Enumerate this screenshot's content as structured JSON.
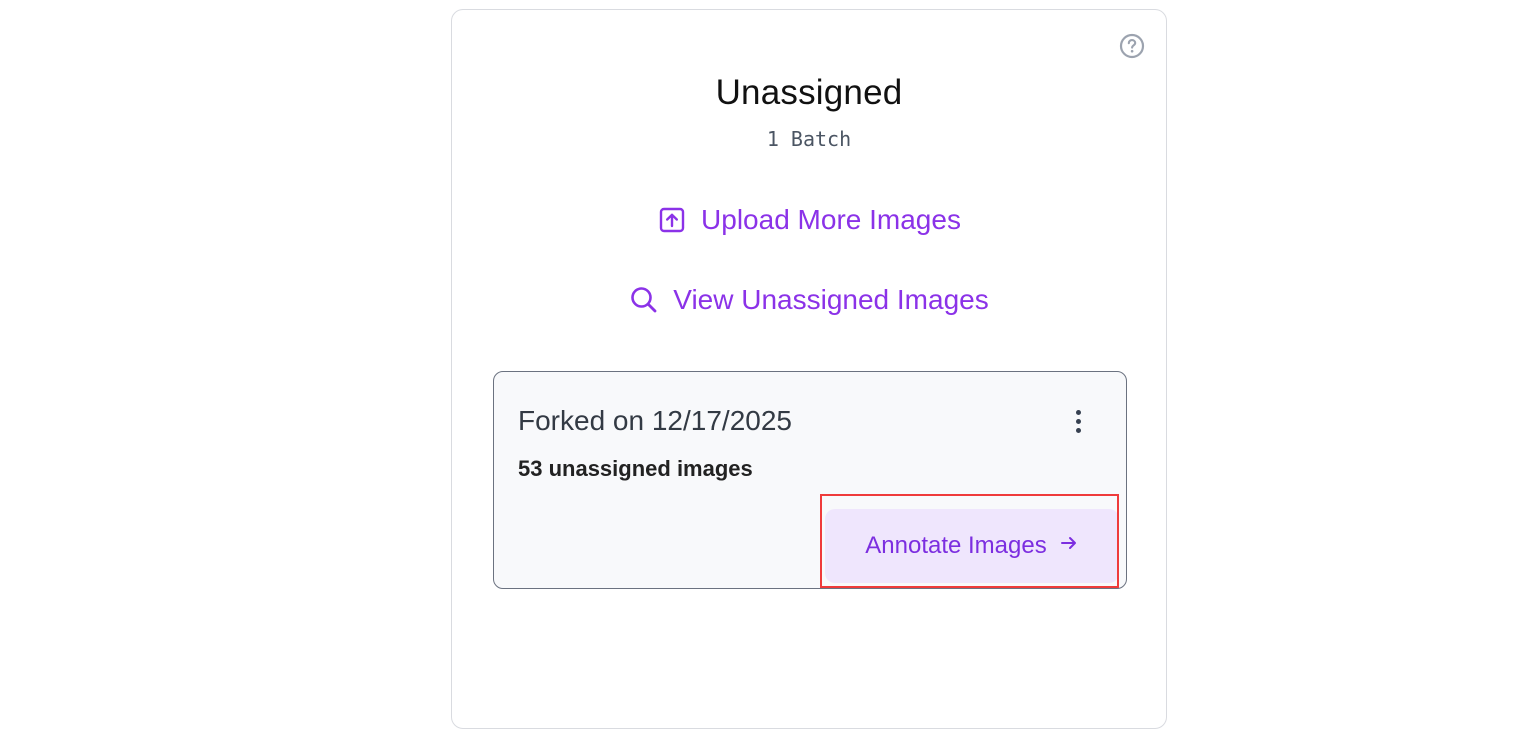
{
  "panel": {
    "title": "Unassigned",
    "subtitle": "1 Batch",
    "help_icon": "question-circle-icon"
  },
  "actions": {
    "upload_label": "Upload More Images",
    "upload_icon": "upload-icon",
    "view_label": "View Unassigned Images",
    "view_icon": "search-icon"
  },
  "batch": {
    "title": "Forked on 12/17/2025",
    "count_label": "53 unassigned images",
    "menu_icon": "kebab-menu-icon",
    "button_label": "Annotate Images",
    "button_icon": "arrow-right-icon"
  },
  "colors": {
    "accent": "#8b32e8",
    "button_bg": "#efe6fd",
    "highlight": "#ef3b3b"
  }
}
